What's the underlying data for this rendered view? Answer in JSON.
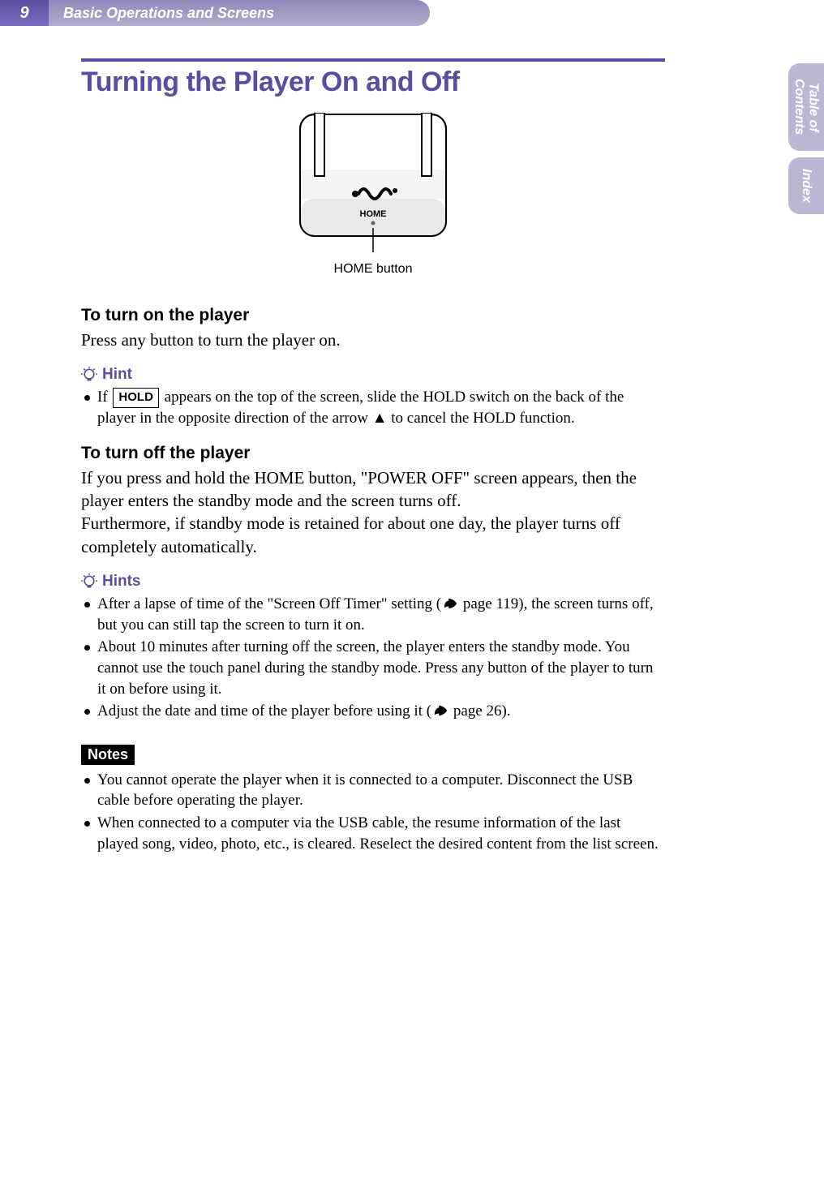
{
  "header": {
    "page_number": "9",
    "chapter": "Basic Operations and Screens"
  },
  "side_tabs": {
    "toc_line1": "Table of",
    "toc_line2": "Contents",
    "index": "Index"
  },
  "title": "Turning the Player On and Off",
  "device": {
    "home_label": "HOME",
    "caption": "HOME button"
  },
  "sections": {
    "turn_on_heading": "To turn on the player",
    "turn_on_body": "Press any button to turn the player on.",
    "hint_single_label": "Hint",
    "hint1_prefix": "If ",
    "hold_badge": "HOLD",
    "hint1_suffix": " appears on the top of the screen, slide the HOLD switch on the back of the player in the opposite direction of the arrow ▲ to cancel the HOLD function.",
    "turn_off_heading": "To turn off the player",
    "turn_off_body": "If you press and hold the HOME button, \"POWER OFF\" screen appears, then the player enters the standby mode and the screen turns off.\nFurthermore, if standby mode is retained for about one day, the player turns off completely automatically.",
    "hints_label": "Hints",
    "hints_items": [
      {
        "pre": "After a lapse of time of the \"Screen Off Timer\" setting (",
        "page_ref": " page 119",
        "post": "), the screen turns off, but you can still tap the screen to turn it on."
      },
      {
        "pre": "About 10 minutes after turning off the screen, the player enters the standby mode. You cannot use the touch panel during the standby mode. Press any button of the player to turn it on before using it.",
        "page_ref": "",
        "post": ""
      },
      {
        "pre": "Adjust the date and time of the player before using it (",
        "page_ref": " page 26",
        "post": ")."
      }
    ],
    "notes_label": "Notes",
    "notes_items": [
      "You cannot operate the player when it is connected to a computer. Disconnect the USB cable before operating the player.",
      "When connected to a computer via the USB cable, the resume information of the last played song, video, photo, etc., is cleared. Reselect the desired content from the list screen."
    ]
  }
}
